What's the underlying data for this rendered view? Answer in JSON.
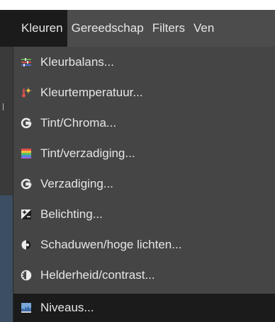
{
  "menubar": {
    "items": [
      {
        "label": "Kleuren"
      },
      {
        "label": "Gereedschap"
      },
      {
        "label": "Filters"
      },
      {
        "label": "Ven"
      }
    ]
  },
  "menu": {
    "items": [
      {
        "label": "Kleurbalans...",
        "icon": "color-balance-icon"
      },
      {
        "label": "Kleurtemperatuur...",
        "icon": "color-temperature-icon"
      },
      {
        "label": "Tint/Chroma...",
        "icon": "hue-chroma-icon"
      },
      {
        "label": "Tint/verzadiging...",
        "icon": "hue-saturation-icon"
      },
      {
        "label": "Verzadiging...",
        "icon": "saturation-icon"
      },
      {
        "label": "Belichting...",
        "icon": "exposure-icon"
      },
      {
        "label": "Schaduwen/hoge lichten...",
        "icon": "shadows-highlights-icon"
      },
      {
        "label": "Helderheid/contrast...",
        "icon": "brightness-contrast-icon"
      },
      {
        "label": "Niveaus...",
        "icon": "levels-icon"
      }
    ]
  }
}
